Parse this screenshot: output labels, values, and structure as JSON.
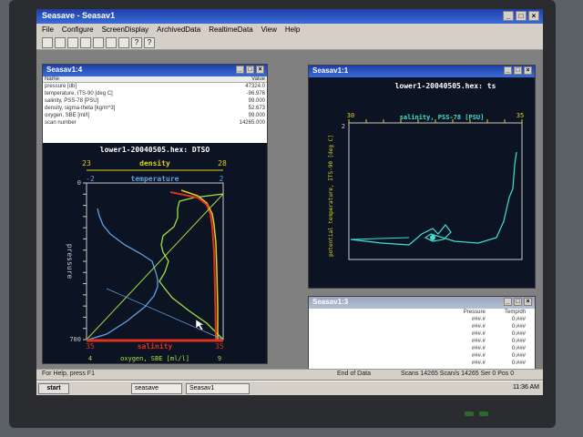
{
  "app": {
    "title": "Seasave - Seasav1"
  },
  "menu": [
    "File",
    "Configure",
    "ScreenDisplay",
    "ArchivedData",
    "RealtimeData",
    "View",
    "Help"
  ],
  "fixed_window": {
    "title": "Seasav1:4",
    "headers": [
      "Name",
      "Value"
    ],
    "rows": [
      [
        "pressure [db]",
        "47324.0"
      ],
      [
        "temperature, ITS-90 [deg C]",
        "-96.976"
      ],
      [
        "salinity, PSS-78 [PSU]",
        "99.000"
      ],
      [
        "density, sigma-theta [kg/m^3]",
        "52.673"
      ],
      [
        "oxygen, SBE [ml/l]",
        "99.000"
      ],
      [
        "scan number",
        "14265.000"
      ]
    ]
  },
  "plot1": {
    "title": "lower1-20040505.hex: DTSO",
    "ylabel": "pressure",
    "axes": {
      "density": {
        "label": "density",
        "min": "23",
        "max": "28"
      },
      "temperature": {
        "label": "temperature",
        "min": "-2",
        "max": "2"
      },
      "salinity": {
        "label": "salinity",
        "min": "35",
        "max": "35"
      },
      "oxygen": {
        "label": "oxygen, SBE [ml/l]",
        "min": "4",
        "max": "9"
      },
      "pressure": {
        "top": "0",
        "bottom": "700"
      }
    },
    "colors": {
      "density": "#e0d020",
      "temperature": "#5fa0e0",
      "salinity": "#e03020",
      "oxygen": "#a0e040",
      "frame": "#c8c8c8"
    }
  },
  "plot2": {
    "window_title": "Seasav1:1",
    "title": "lower1-20040505.hex: ts",
    "xlabel": "salinity, PSS-78 [PSU]",
    "ylabel": "potential temperature, ITS-90 [deg C]",
    "x_min": "30",
    "x_max": "35",
    "y_top": "2",
    "color": "#40e0d0"
  },
  "bottom_window": {
    "title": "Seasav1:3",
    "headers": [
      "Pressure",
      "Temp/dh"
    ],
    "rows": [
      [
        "###.#",
        "0.###"
      ],
      [
        "###.#",
        "0.###"
      ],
      [
        "###.#",
        "0.###"
      ],
      [
        "###.#",
        "0.###"
      ],
      [
        "###.#",
        "0.###"
      ],
      [
        "###.#",
        "0.###"
      ],
      [
        "###.#",
        "0.###"
      ]
    ]
  },
  "status": {
    "left": "For Help, press F1",
    "middle": "End of Data",
    "right": "Scans 14265 Scan/s 14265 Ser 0 Pos 0"
  },
  "taskbar": {
    "start": "start",
    "task1": "seasave",
    "task2": "Seasav1",
    "clock": "11:36 AM"
  }
}
